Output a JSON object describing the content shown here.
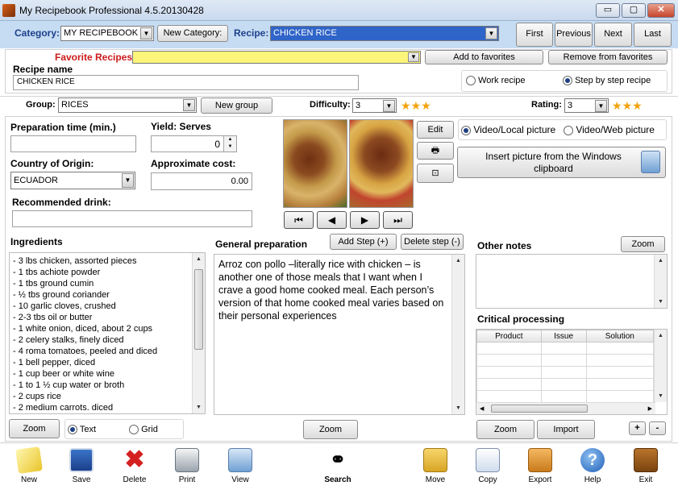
{
  "window": {
    "title": "My Recipebook Professional 4.5.20130428",
    "min": "▭",
    "max": "▢",
    "close": "✕"
  },
  "top": {
    "category_label": "Category:",
    "category_value": "MY RECIPEBOOK",
    "new_category": "New Category:",
    "recipe_label": "Recipe:",
    "recipe_value": "CHICKEN RICE",
    "nav": [
      "First",
      "Previous",
      "Next",
      "Last"
    ]
  },
  "favorites": {
    "label": "Favorite Recipes",
    "value": "",
    "add": "Add to favorites",
    "remove": "Remove from favorites"
  },
  "recipe_name": {
    "label": "Recipe name",
    "value": "CHICKEN RICE"
  },
  "mode": {
    "work": "Work recipe",
    "step": "Step by step recipe",
    "selected": "step"
  },
  "group": {
    "label": "Group:",
    "value": "RICES",
    "new_group": "New group"
  },
  "difficulty": {
    "label": "Difficulty:",
    "value": "3",
    "stars": 3
  },
  "rating": {
    "label": "Rating:",
    "value": "3",
    "stars": 3
  },
  "prep_time": {
    "label": "Preparation time (min.)",
    "value": ""
  },
  "yield": {
    "label": "Yield: Serves",
    "value": "0"
  },
  "country": {
    "label": "Country of Origin:",
    "value": "ECUADOR"
  },
  "cost": {
    "label": "Approximate cost:",
    "value": "0.00"
  },
  "drink": {
    "label": "Recommended drink:",
    "value": ""
  },
  "picture": {
    "edit": "Edit",
    "video_local": "Video/Local picture",
    "video_web": "Video/Web picture",
    "selected": "local",
    "insert": "Insert picture from the Windows clipboard"
  },
  "ingredients": {
    "label": "Ingredients",
    "items": [
      "- 3 lbs chicken, assorted pieces",
      "- 1 tbs achiote powder",
      "- 1 tbs ground cumin",
      "- ½ tbs ground coriander",
      "- 10 garlic cloves, crushed",
      "- 2-3 tbs oil or butter",
      "- 1 white onion, diced, about 2 cups",
      "- 2 celery stalks, finely diced",
      "- 4 roma tomatoes, peeled and diced",
      "- 1 bell pepper, diced",
      "- 1 cup beer or white wine",
      "- 1 to 1 ½ cup water or broth",
      "- 2 cups rice",
      "- 2 medium carrots. diced"
    ],
    "zoom": "Zoom",
    "text_opt": "Text",
    "grid_opt": "Grid",
    "selected": "text"
  },
  "general": {
    "label": "General preparation",
    "add_step": "Add Step (+)",
    "delete_step": "Delete step (-)",
    "text": "Arroz con pollo –literally rice with chicken – is another one of those meals that I want when I crave a good home cooked meal. Each person’s version of that home cooked meal varies based on their personal experiences",
    "zoom": "Zoom"
  },
  "other_notes": {
    "label": "Other notes",
    "zoom": "Zoom",
    "value": ""
  },
  "critical": {
    "label": "Critical processing",
    "columns": [
      "Product",
      "Issue",
      "Solution"
    ],
    "zoom": "Zoom",
    "import": "Import",
    "plus": "+",
    "minus": "-"
  },
  "toolbar": [
    "New",
    "Save",
    "Delete",
    "Print",
    "View",
    "Search",
    "Move",
    "Copy",
    "Export",
    "Help",
    "Exit"
  ]
}
